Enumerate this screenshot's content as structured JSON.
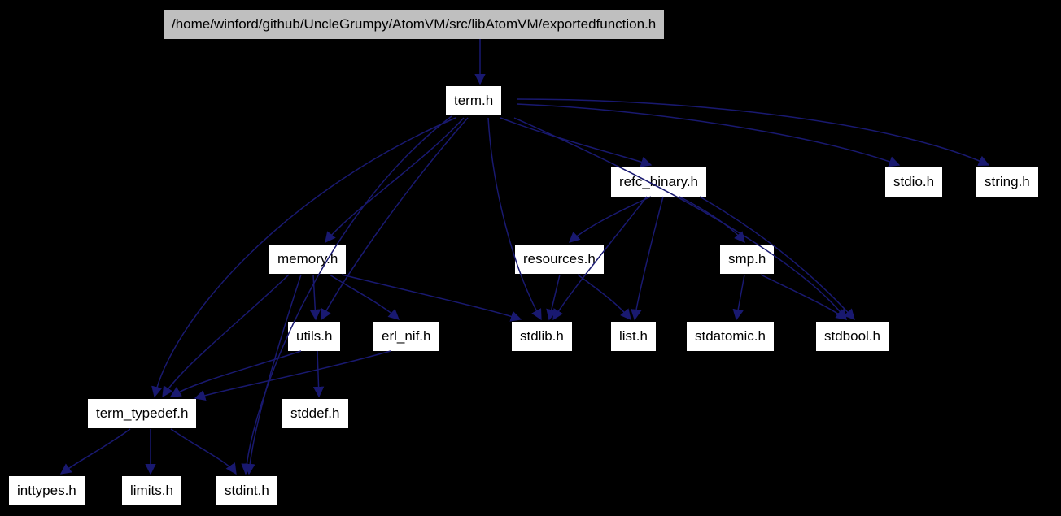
{
  "diagram_type": "include-dependency-graph",
  "nodes": {
    "root": "/home/winford/github/UncleGrumpy/AtomVM/src/libAtomVM/exportedfunction.h",
    "term": "term.h",
    "refc_binary": "refc_binary.h",
    "stdio": "stdio.h",
    "string": "string.h",
    "memory": "memory.h",
    "resources": "resources.h",
    "smp": "smp.h",
    "utils": "utils.h",
    "erl_nif": "erl_nif.h",
    "stdlib": "stdlib.h",
    "list": "list.h",
    "stdatomic": "stdatomic.h",
    "stdbool": "stdbool.h",
    "term_typedef": "term_typedef.h",
    "stddef": "stddef.h",
    "inttypes": "inttypes.h",
    "limits": "limits.h",
    "stdint": "stdint.h"
  },
  "edges": [
    [
      "root",
      "term"
    ],
    [
      "term",
      "memory"
    ],
    [
      "term",
      "refc_binary"
    ],
    [
      "term",
      "stdio"
    ],
    [
      "term",
      "string"
    ],
    [
      "term",
      "stdlib"
    ],
    [
      "term",
      "stdbool"
    ],
    [
      "term",
      "term_typedef"
    ],
    [
      "term",
      "utils"
    ],
    [
      "term",
      "stdint"
    ],
    [
      "refc_binary",
      "resources"
    ],
    [
      "refc_binary",
      "smp"
    ],
    [
      "refc_binary",
      "stdlib"
    ],
    [
      "refc_binary",
      "list"
    ],
    [
      "refc_binary",
      "stdbool"
    ],
    [
      "memory",
      "utils"
    ],
    [
      "memory",
      "erl_nif"
    ],
    [
      "memory",
      "stdlib"
    ],
    [
      "memory",
      "stdint"
    ],
    [
      "memory",
      "term_typedef"
    ],
    [
      "resources",
      "stdlib"
    ],
    [
      "resources",
      "list"
    ],
    [
      "smp",
      "stdatomic"
    ],
    [
      "smp",
      "stdbool"
    ],
    [
      "utils",
      "stddef"
    ],
    [
      "utils",
      "term_typedef"
    ],
    [
      "erl_nif",
      "term_typedef"
    ],
    [
      "term_typedef",
      "inttypes"
    ],
    [
      "term_typedef",
      "limits"
    ],
    [
      "term_typedef",
      "stdint"
    ]
  ]
}
